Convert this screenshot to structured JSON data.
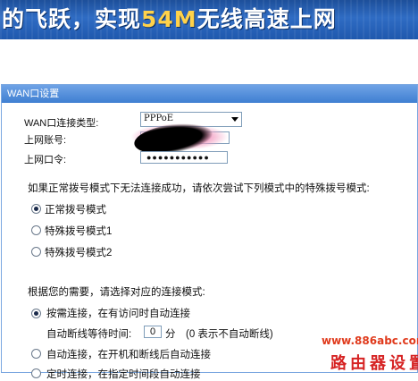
{
  "banner": {
    "text_prefix": "的飞跃，实现",
    "text_highlight": "54M",
    "text_suffix": "无线高速上网"
  },
  "panel": {
    "title": "WAN口设置",
    "wan_type_label": "WAN口连接类型:",
    "wan_type_value": "PPPoE",
    "account_label": "上网账号:",
    "password_label": "上网口令:",
    "password_value": "●●●●●●●●●●●",
    "hint": "如果正常拨号模式下无法连接成功，请依次尝试下列模式中的特殊拨号模式:",
    "dial_modes": [
      {
        "label": "正常拨号模式",
        "checked": true
      },
      {
        "label": "特殊拨号模式1",
        "checked": false
      },
      {
        "label": "特殊拨号模式2",
        "checked": false
      }
    ],
    "connect_hint": "根据您的需要，请选择对应的连接模式:",
    "connect_modes": [
      {
        "label": "按需连接，在有访问时自动连接",
        "checked": true
      },
      {
        "label": "自动连接，在开机和断线后自动连接",
        "checked": false
      },
      {
        "label": "定时连接，在指定时间段自动连接",
        "checked": false
      }
    ],
    "idle_label": "自动断线等待时间:",
    "idle_value": "0",
    "idle_unit": "分",
    "idle_note": "(0 表示不自动断线)"
  },
  "watermark": {
    "url": "www.886abc.com",
    "name": "路由器设置"
  },
  "colors": {
    "banner": "#2f6cc4",
    "panel_border": "#7aa7e0",
    "watermark": "#d62424"
  }
}
